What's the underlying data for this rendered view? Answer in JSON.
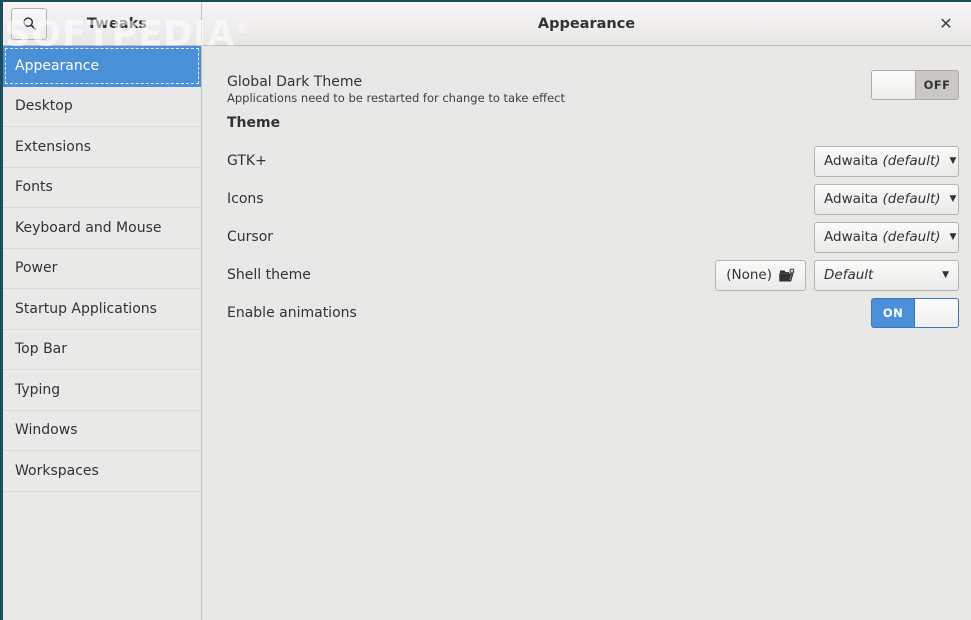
{
  "window": {
    "accent_blue": "#4a90d9",
    "border_color": "#1b4d5c"
  },
  "header": {
    "search_icon": "search-icon",
    "app_title": "Tweaks",
    "page_title": "Appearance",
    "close_label": "✕"
  },
  "watermark": {
    "text": "SOFTPEDIA",
    "mark": "®"
  },
  "sidebar": {
    "items": [
      {
        "label": "Appearance",
        "selected": true
      },
      {
        "label": "Desktop",
        "selected": false
      },
      {
        "label": "Extensions",
        "selected": false
      },
      {
        "label": "Fonts",
        "selected": false
      },
      {
        "label": "Keyboard and Mouse",
        "selected": false
      },
      {
        "label": "Power",
        "selected": false
      },
      {
        "label": "Startup Applications",
        "selected": false
      },
      {
        "label": "Top Bar",
        "selected": false
      },
      {
        "label": "Typing",
        "selected": false
      },
      {
        "label": "Windows",
        "selected": false
      },
      {
        "label": "Workspaces",
        "selected": false
      }
    ]
  },
  "main": {
    "dark_theme": {
      "label": "Global Dark Theme",
      "description": "Applications need to be restarted for change to take effect",
      "switch_state": "OFF"
    },
    "section_theme": "Theme",
    "gtk": {
      "label": "GTK+",
      "value": "Adwaita",
      "value_suffix": "(default)",
      "arrow": "▼"
    },
    "icons": {
      "label": "Icons",
      "value": "Adwaita",
      "value_suffix": "(default)",
      "arrow": "▼"
    },
    "cursor": {
      "label": "Cursor",
      "value": "Adwaita",
      "value_suffix": "(default)",
      "arrow": "▼"
    },
    "shell_theme": {
      "label": "Shell theme",
      "file_value": "(None)",
      "file_icon": "folder-open-icon",
      "value": "Default",
      "arrow": "▼"
    },
    "animations": {
      "label": "Enable animations",
      "switch_state": "ON"
    }
  }
}
